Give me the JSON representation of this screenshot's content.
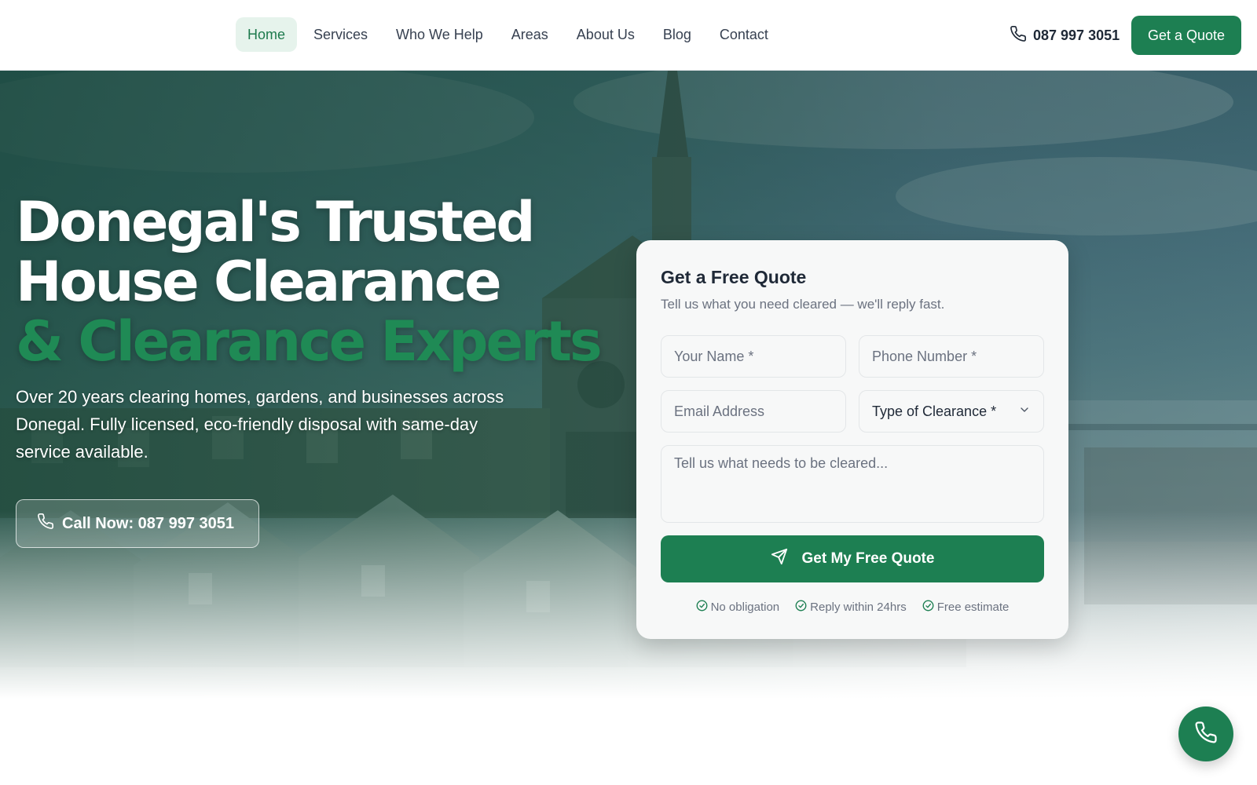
{
  "header": {
    "nav": [
      {
        "label": "Home",
        "active": true
      },
      {
        "label": "Services"
      },
      {
        "label": "Who We Help"
      },
      {
        "label": "Areas"
      },
      {
        "label": "About Us"
      },
      {
        "label": "Blog"
      },
      {
        "label": "Contact"
      }
    ],
    "phone": "087 997 3051",
    "cta_label": "Get a Quote"
  },
  "hero": {
    "headline_line1": "Donegal's Trusted",
    "headline_line2": "House Clearance",
    "headline_accent": "& Clearance Experts",
    "subtitle": "Over 20 years clearing homes, gardens, and businesses across Donegal. Fully licensed, eco-friendly disposal with same-day service available.",
    "call_button_label": "Call Now: 087 997 3051"
  },
  "quote_form": {
    "title": "Get a Free Quote",
    "subtitle": "Tell us what you need cleared — we'll reply fast.",
    "name_placeholder": "Your Name *",
    "phone_placeholder": "Phone Number *",
    "email_placeholder": "Email Address",
    "clearance_type_value": "Type of Clearance *",
    "message_placeholder": "Tell us what needs to be cleared...",
    "submit_label": "Get My Free Quote",
    "badges": [
      "No obligation",
      "Reply within 24hrs",
      "Free estimate"
    ]
  },
  "colors": {
    "brand_green": "#1d7f52",
    "accent_green_text": "#1f8a55",
    "nav_active_bg": "#e6f3ec"
  },
  "icons": {
    "header_phone": "phone-icon",
    "call_button": "phone-icon",
    "submit": "send-icon",
    "badge": "check-circle-icon",
    "select": "chevron-down-icon",
    "floating": "phone-icon"
  }
}
